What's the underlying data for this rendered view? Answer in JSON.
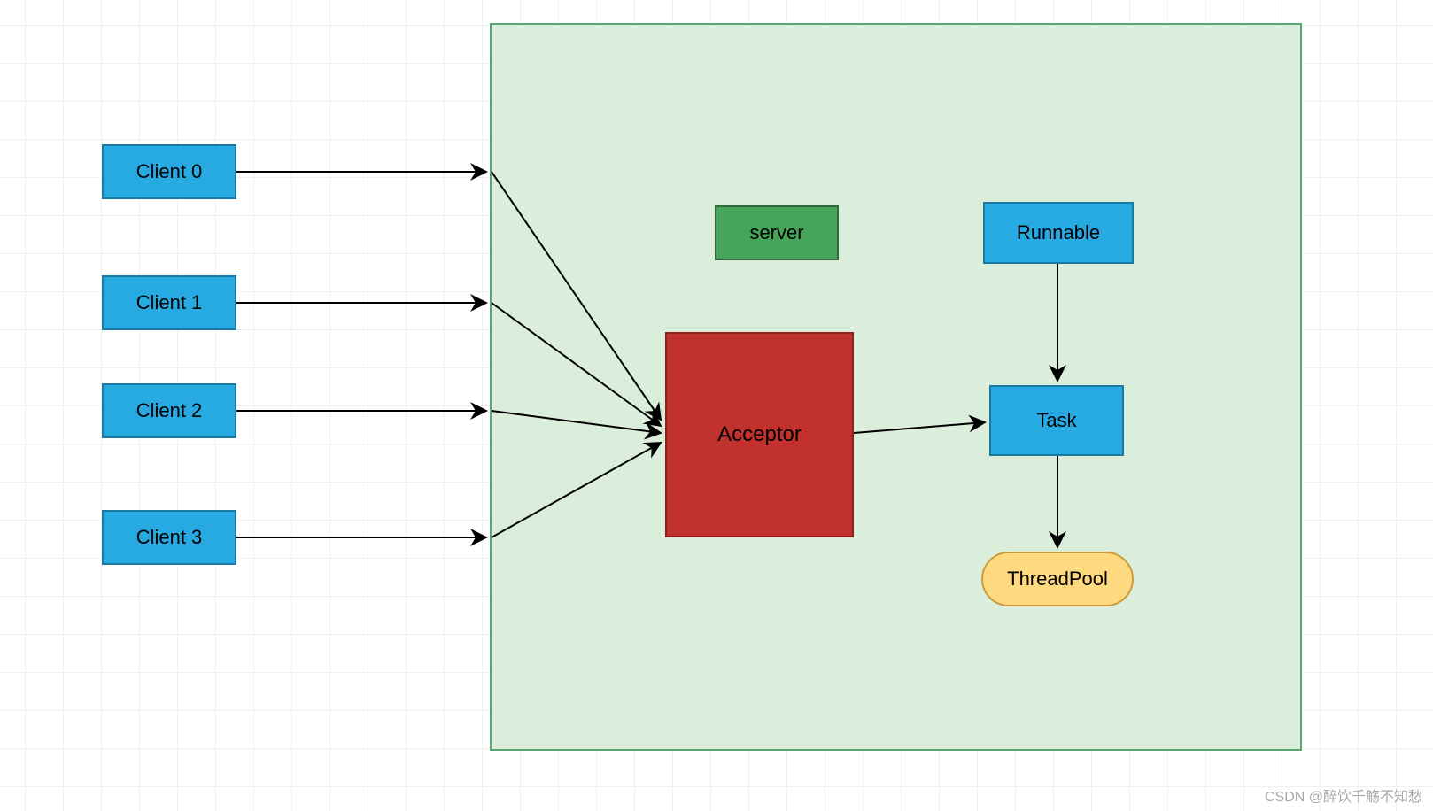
{
  "clients": [
    {
      "label": "Client 0"
    },
    {
      "label": "Client 1"
    },
    {
      "label": "Client 2"
    },
    {
      "label": "Client 3"
    }
  ],
  "server": {
    "label": "server"
  },
  "acceptor": {
    "label": "Acceptor"
  },
  "runnable": {
    "label": "Runnable"
  },
  "task": {
    "label": "Task"
  },
  "threadpool": {
    "label": "ThreadPool"
  },
  "watermark": "CSDN @醉饮千觞不知愁",
  "colors": {
    "blue": "#27aae1",
    "green": "#47a55b",
    "red": "#c1322e",
    "yellow": "#ffd97f",
    "container": "#dbeddb"
  }
}
